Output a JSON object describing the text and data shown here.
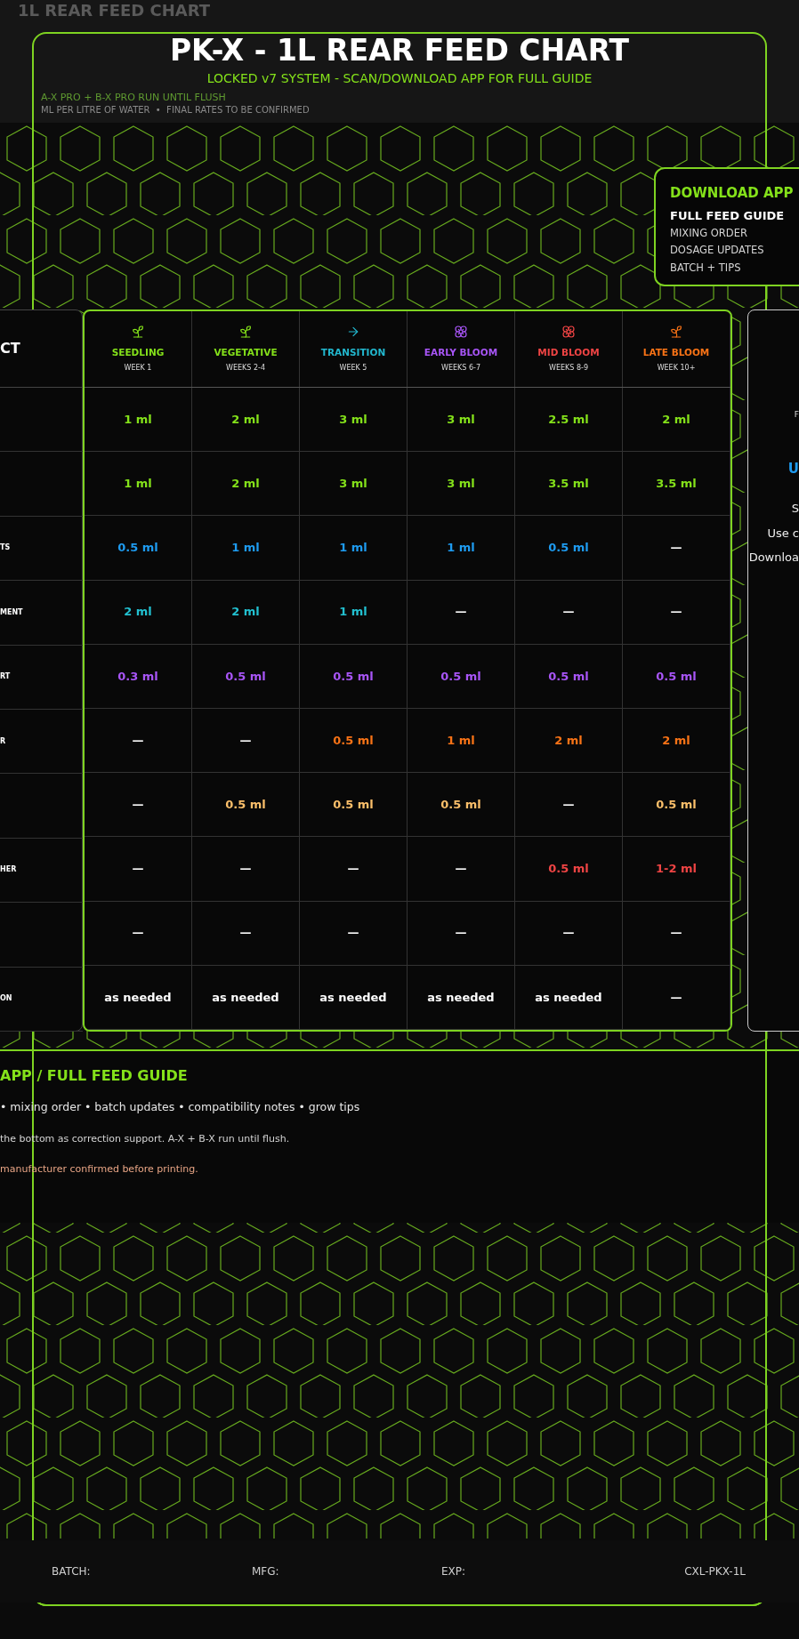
{
  "header": {
    "watermark_title": "1L REAR FEED CHART",
    "watermark_subtitle": "A-X PRO + B-X PRO RUN UNTIL FLUSH",
    "watermark_note": "ML PER LITRE OF WATER  •  FINAL RATES TO BE CONFIRMED",
    "title": "PK-X - 1L REAR FEED CHART",
    "subtitle": "LOCKED v7 SYSTEM - SCAN/DOWNLOAD APP FOR FULL GUIDE"
  },
  "download_box": {
    "title": "DOWNLOAD APP",
    "heading": "FULL FEED GUIDE",
    "lines": [
      "MIXING ORDER",
      "DOSAGE UPDATES",
      "BATCH + TIPS"
    ]
  },
  "product_column": {
    "heading": "CT"
  },
  "stages": [
    {
      "name": "SEEDLING",
      "week": "WEEK 1",
      "kind": "sprout",
      "color": "#84e11a"
    },
    {
      "name": "VEGETATIVE",
      "week": "WEEKS 2-4",
      "kind": "sprout",
      "color": "#84e11a"
    },
    {
      "name": "TRANSITION",
      "week": "WEEK 5",
      "kind": "arrow",
      "color": "#22b8cf"
    },
    {
      "name": "EARLY BLOOM",
      "week": "WEEKS 6-7",
      "kind": "flower",
      "color": "#a855f7"
    },
    {
      "name": "MID BLOOM",
      "week": "WEEKS 8-9",
      "kind": "flower",
      "color": "#ef4444"
    },
    {
      "name": "LATE BLOOM",
      "week": "WEEK 10+",
      "kind": "sprout",
      "color": "#f97316"
    }
  ],
  "rows": [
    {
      "color": "#84e11a",
      "cells": [
        {
          "value": "1 ml",
          "kind": "dose"
        },
        {
          "value": "2 ml",
          "kind": "dose"
        },
        {
          "value": "3 ml",
          "kind": "dose"
        },
        {
          "value": "3 ml",
          "kind": "dose"
        },
        {
          "value": "2.5 ml",
          "kind": "dose"
        },
        {
          "value": "2 ml",
          "kind": "dose"
        }
      ]
    },
    {
      "color": "#84e11a",
      "cells": [
        {
          "value": "1 ml",
          "kind": "dose"
        },
        {
          "value": "2 ml",
          "kind": "dose"
        },
        {
          "value": "3 ml",
          "kind": "dose"
        },
        {
          "value": "3 ml",
          "kind": "dose"
        },
        {
          "value": "3.5 ml",
          "kind": "dose"
        },
        {
          "value": "3.5 ml",
          "kind": "dose"
        }
      ]
    },
    {
      "label": "TS",
      "color": "#1e9bf0",
      "cells": [
        {
          "value": "0.5 ml",
          "kind": "dose"
        },
        {
          "value": "1 ml",
          "kind": "dose"
        },
        {
          "value": "1 ml",
          "kind": "dose"
        },
        {
          "value": "1 ml",
          "kind": "dose"
        },
        {
          "value": "0.5 ml",
          "kind": "dose"
        },
        {
          "value": "—",
          "kind": "none"
        }
      ]
    },
    {
      "label": "MENT",
      "color": "#22c0d0",
      "cells": [
        {
          "value": "2 ml",
          "kind": "dose"
        },
        {
          "value": "2 ml",
          "kind": "dose"
        },
        {
          "value": "1 ml",
          "kind": "dose"
        },
        {
          "value": "—",
          "kind": "none"
        },
        {
          "value": "—",
          "kind": "none"
        },
        {
          "value": "—",
          "kind": "none"
        }
      ]
    },
    {
      "label": "RT",
      "color": "#a855f7",
      "cells": [
        {
          "value": "0.3 ml",
          "kind": "dose"
        },
        {
          "value": "0.5 ml",
          "kind": "dose"
        },
        {
          "value": "0.5 ml",
          "kind": "dose"
        },
        {
          "value": "0.5 ml",
          "kind": "dose"
        },
        {
          "value": "0.5 ml",
          "kind": "dose"
        },
        {
          "value": "0.5 ml",
          "kind": "dose"
        }
      ]
    },
    {
      "label": "R",
      "color": "#f97316",
      "cells": [
        {
          "value": "—",
          "kind": "none"
        },
        {
          "value": "—",
          "kind": "none"
        },
        {
          "value": "0.5 ml",
          "kind": "dose"
        },
        {
          "value": "1 ml",
          "kind": "dose"
        },
        {
          "value": "2 ml",
          "kind": "dose"
        },
        {
          "value": "2 ml",
          "kind": "dose"
        }
      ]
    },
    {
      "color": "#fbbf6a",
      "cells": [
        {
          "value": "—",
          "kind": "none"
        },
        {
          "value": "0.5 ml",
          "kind": "dose"
        },
        {
          "value": "0.5 ml",
          "kind": "dose"
        },
        {
          "value": "0.5 ml",
          "kind": "dose"
        },
        {
          "value": "—",
          "kind": "none"
        },
        {
          "value": "0.5 ml",
          "kind": "dose"
        }
      ]
    },
    {
      "label": "HER",
      "color": "#ef4444",
      "cells": [
        {
          "value": "—",
          "kind": "none"
        },
        {
          "value": "—",
          "kind": "none"
        },
        {
          "value": "—",
          "kind": "none"
        },
        {
          "value": "—",
          "kind": "none"
        },
        {
          "value": "0.5 ml",
          "kind": "dose"
        },
        {
          "value": "1-2 ml",
          "kind": "dose"
        }
      ]
    },
    {
      "cells": [
        {
          "value": "—",
          "kind": "none"
        },
        {
          "value": "—",
          "kind": "none"
        },
        {
          "value": "—",
          "kind": "none"
        },
        {
          "value": "—",
          "kind": "none"
        },
        {
          "value": "—",
          "kind": "none"
        },
        {
          "value": "—",
          "kind": "none"
        }
      ]
    },
    {
      "label": "ON",
      "cells": [
        {
          "value": "as needed",
          "kind": "none"
        },
        {
          "value": "as needed",
          "kind": "none"
        },
        {
          "value": "as needed",
          "kind": "none"
        },
        {
          "value": "as needed",
          "kind": "none"
        },
        {
          "value": "as needed",
          "kind": "none"
        },
        {
          "value": "—",
          "kind": "none"
        }
      ]
    }
  ],
  "side_panel": {
    "lines": [
      {
        "text": "F",
        "kind": "small"
      },
      {
        "text": "U",
        "kind": "accent"
      },
      {
        "text": "S",
        "kind": "body"
      },
      {
        "text": "Use c",
        "kind": "body"
      },
      {
        "text": "Downloa",
        "kind": "body"
      }
    ]
  },
  "info": {
    "title": "APP / FULL FEED GUIDE",
    "features": "• mixing order • batch updates • compatibility notes • grow tips",
    "note": "the bottom as correction support. A-X + B-X run until flush.",
    "warning": "manufacturer confirmed before printing."
  },
  "footer": {
    "batch": "BATCH:",
    "mfg": "MFG:",
    "exp": "EXP:",
    "code": "CXL-PKX-1L"
  }
}
